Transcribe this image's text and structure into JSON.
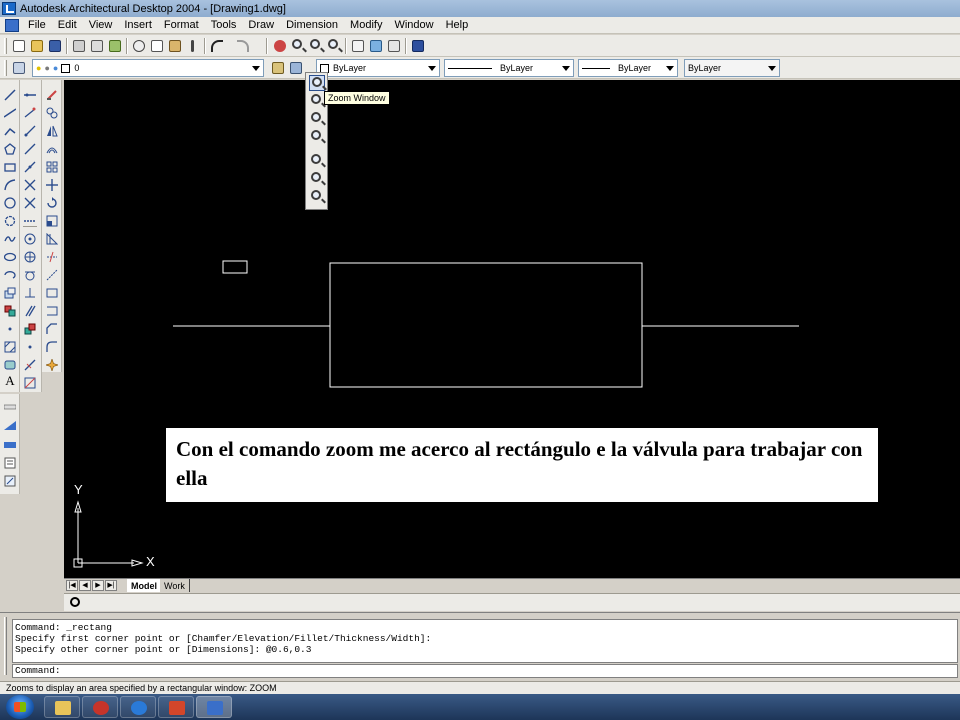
{
  "window": {
    "title": "Autodesk Architectural Desktop 2004 - [Drawing1.dwg]"
  },
  "menu": {
    "items": [
      "File",
      "Edit",
      "View",
      "Insert",
      "Format",
      "Tools",
      "Draw",
      "Dimension",
      "Modify",
      "Window",
      "Help"
    ]
  },
  "properties_toolbar": {
    "layer_value": "0",
    "color_value": "ByLayer",
    "linetype_value": "ByLayer",
    "lineweight_value": "ByLayer",
    "plotstyle_value": "ByLayer"
  },
  "zoom_flyout": {
    "tooltip": "Zoom Window"
  },
  "caption": {
    "text": "Con el comando zoom me acerco al rectángulo e la válvula para trabajar con ella"
  },
  "ucs": {
    "x_label": "X",
    "y_label": "Y"
  },
  "layout_tabs": {
    "model": "Model",
    "work": "Work"
  },
  "command_window": {
    "history": [
      "Command: _rectang",
      "Specify first corner point or [Chamfer/Elevation/Fillet/Thickness/Width]:",
      "Specify other corner point or [Dimensions]: @0.6,0.3"
    ],
    "prompt": "Command:"
  },
  "statusbar": {
    "text": "Zooms to display an area specified by a rectangular window:  ZOOM"
  },
  "colors": {
    "drawing_background": "#000000",
    "drawing_lines": "#ffffff",
    "taskbar": "#1d3558"
  }
}
